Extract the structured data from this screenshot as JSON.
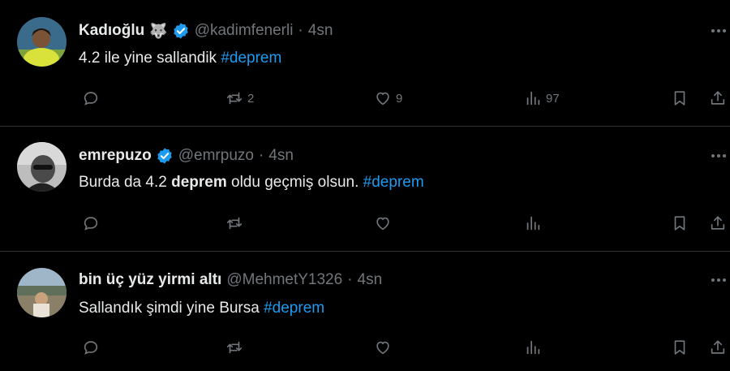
{
  "tweets": [
    {
      "name": "Kadıoğlu",
      "name_emoji": "🐺",
      "handle": "@kadimfenerli",
      "dot": "·",
      "time": "4sn",
      "text_parts": {
        "plain1": "4.2 ile yine sallandik ",
        "hashtag": "#deprem"
      },
      "counts": {
        "replies": "",
        "retweets": "2",
        "likes": "9",
        "views": "97"
      }
    },
    {
      "name": "emrepuzo",
      "handle": "@emrpuzo",
      "dot": "·",
      "time": "4sn",
      "text_parts": {
        "plain1": "Burda da 4.2 ",
        "bold": "deprem",
        "plain2": " oldu geçmiş olsun. ",
        "hashtag": "#deprem"
      },
      "counts": {
        "replies": "",
        "retweets": "",
        "likes": "",
        "views": ""
      }
    },
    {
      "name": "bin üç yüz yirmi altı",
      "handle": "@MehmetY1326",
      "dot": "·",
      "time": "4sn",
      "text_parts": {
        "plain1": "Sallandık şimdi yine Bursa ",
        "hashtag": "#deprem"
      },
      "counts": {
        "replies": "",
        "retweets": "",
        "likes": "",
        "views": ""
      }
    }
  ],
  "colors": {
    "background": "#000000",
    "text": "#e7e9ea",
    "muted": "#71767b",
    "accent": "#1d9bf0",
    "divider": "#2f3336"
  },
  "icons": [
    "verified-badge-icon",
    "more-icon",
    "reply-icon",
    "retweet-icon",
    "like-icon",
    "views-icon",
    "bookmark-icon",
    "share-icon"
  ]
}
